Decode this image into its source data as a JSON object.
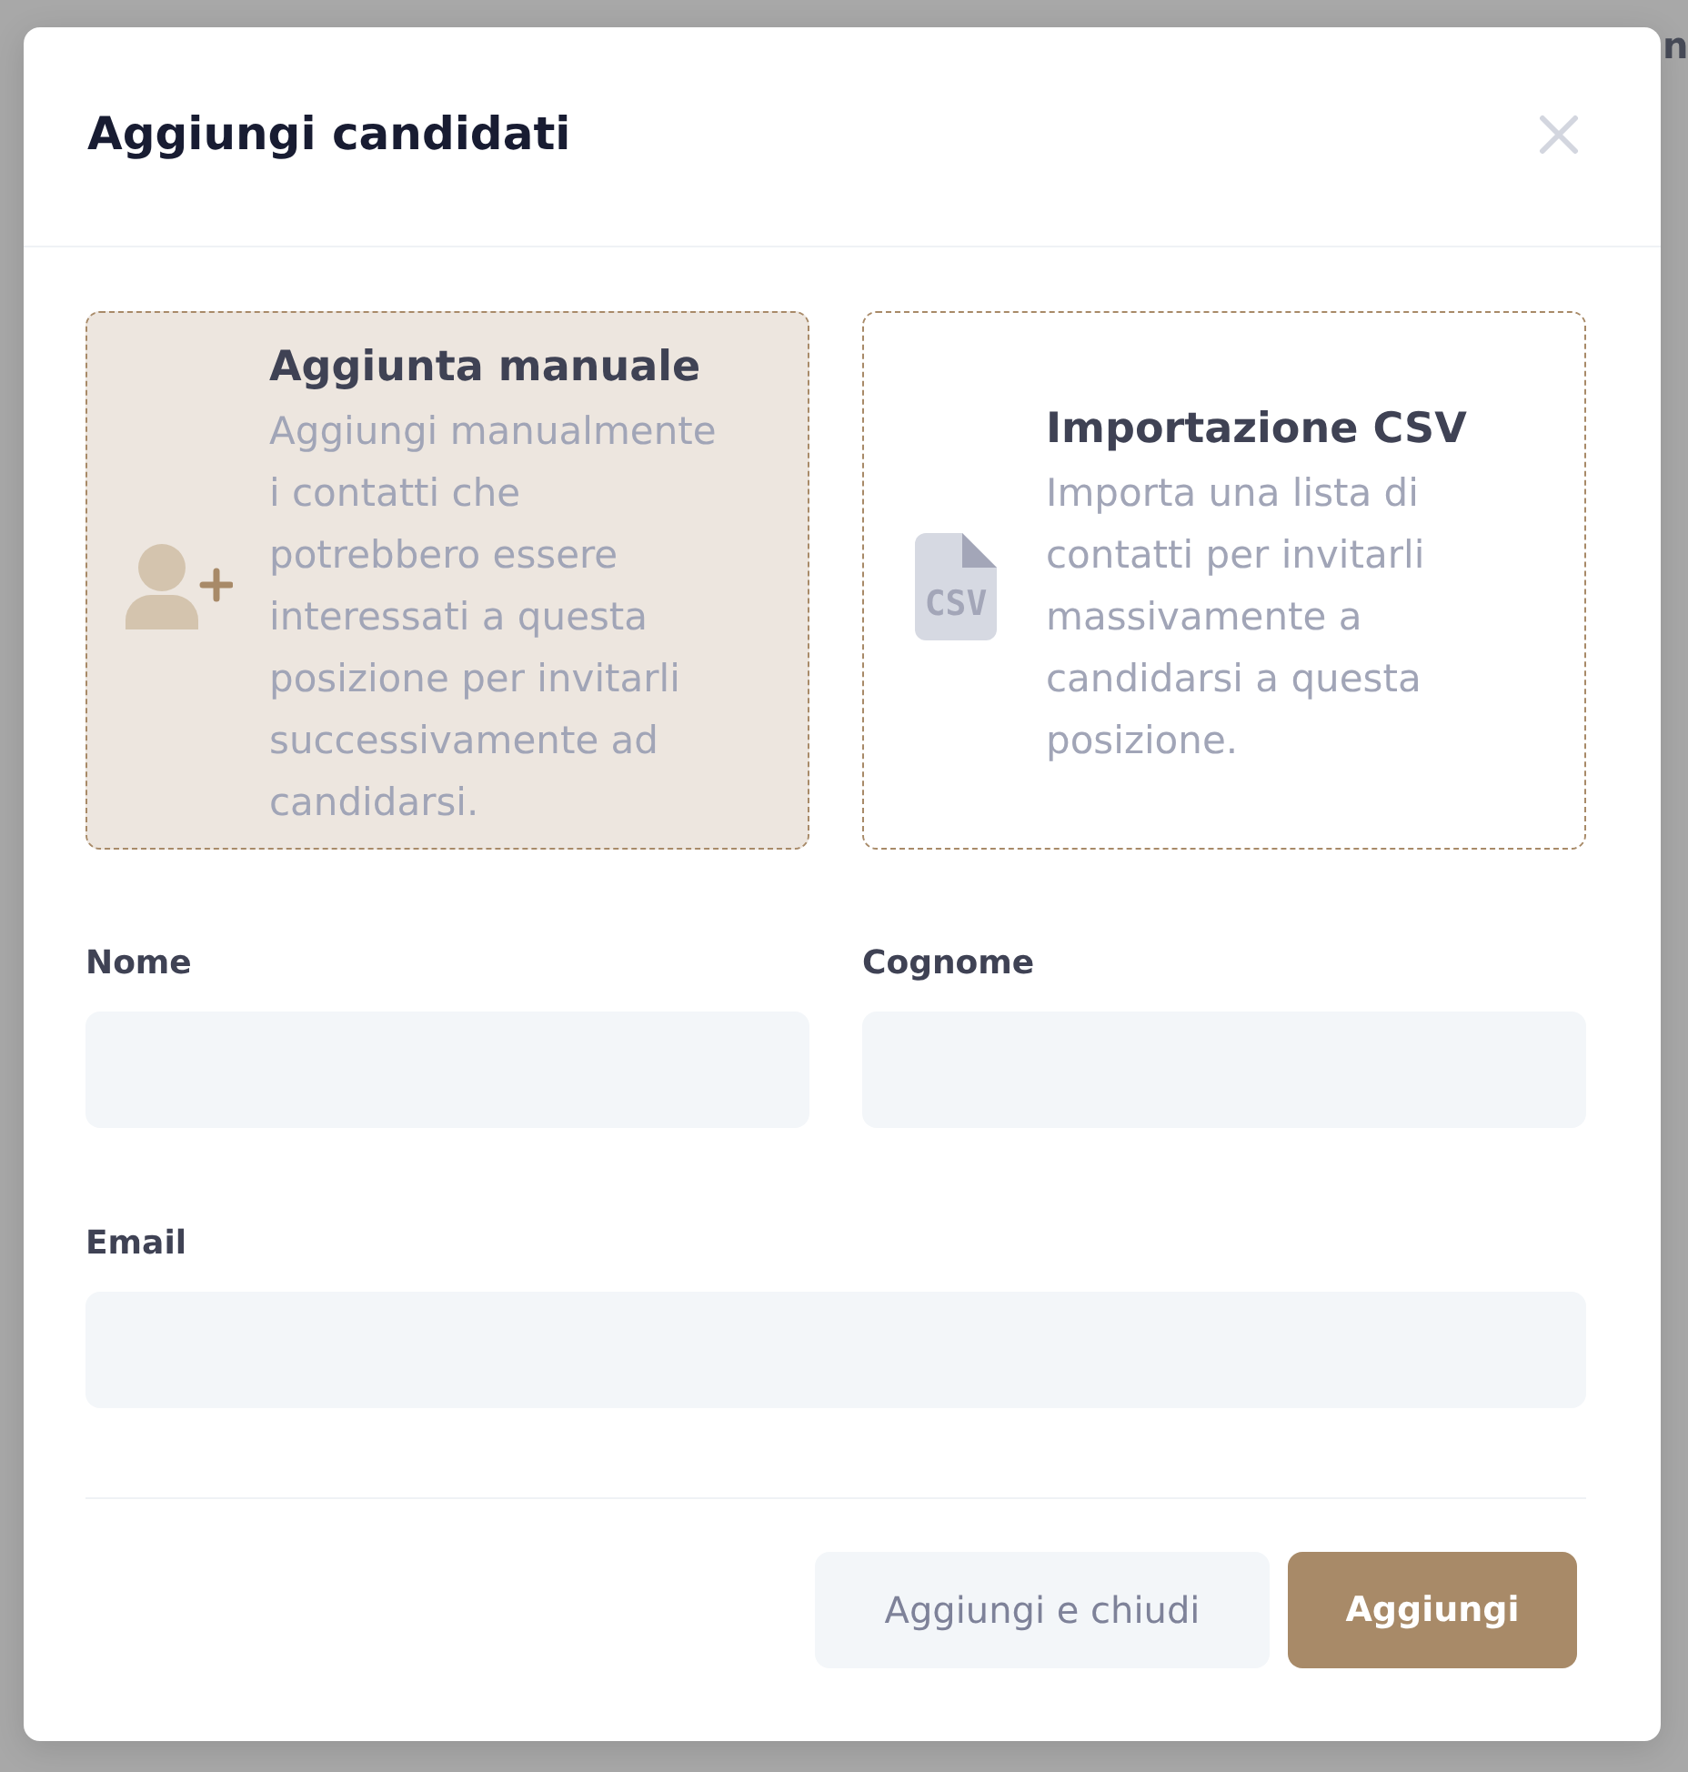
{
  "background": {
    "text_fragment": "n"
  },
  "dialog": {
    "title": "Aggiungi candidati"
  },
  "options": [
    {
      "kind": "manual",
      "title": "Aggiunta manuale",
      "description": "Aggiungi manualmente i contatti che potrebbero essere interessati a questa posizione per invitarli successivamente ad candidarsi.",
      "selected": true
    },
    {
      "kind": "csv",
      "title": "Importazione CSV",
      "icon_label": "CSV",
      "description": "Importa una lista di contatti per invitarli massivamente a candidarsi a questa posizione.",
      "selected": false
    }
  ],
  "field_rows": [
    [
      {
        "label": "Nome"
      },
      {
        "label": "Cognome"
      }
    ],
    [
      {
        "label": "Email"
      }
    ]
  ],
  "buttons": [
    {
      "kind": "secondary",
      "label": "Aggiungi e chiudi"
    },
    {
      "kind": "primary",
      "label": "Aggiungi"
    }
  ]
}
